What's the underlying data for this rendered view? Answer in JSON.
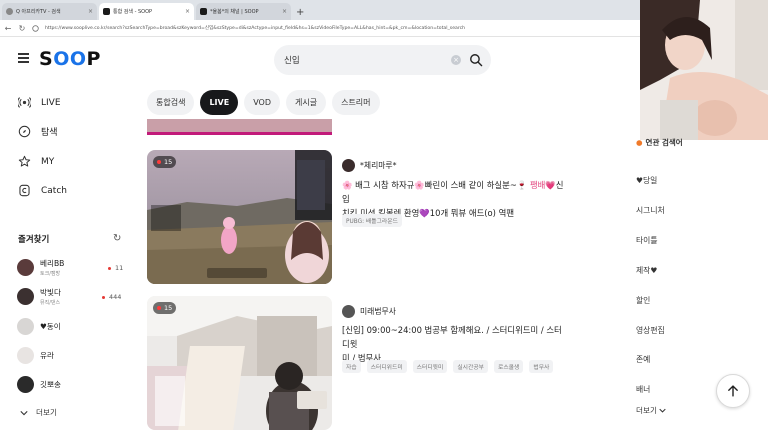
{
  "browser": {
    "tabs": [
      {
        "title": "Q 아프리카TV - 검색",
        "active": false
      },
      {
        "title": "통합 검색 - SOOP",
        "active": true
      },
      {
        "title": "*율봄*의 채널 | SOOP",
        "active": false
      }
    ],
    "new_tab_symbol": "+",
    "url": "https://www.sooplive.co.kr/search?szSearchType=broad&szKeyword=신입&szStype=di&szActype=input_field&hs=1&szVideoFileType=ALL&has_hint=&pk_cm=&location=total_search"
  },
  "header": {
    "logo_text_1": "S",
    "logo_text_2": "OO",
    "logo_text_3": "P",
    "search_value": "신입",
    "clear_symbol": "×"
  },
  "sidebar": {
    "nav": [
      {
        "label": "LIVE",
        "icon": "live-icon"
      },
      {
        "label": "탐색",
        "icon": "explore-icon"
      },
      {
        "label": "MY",
        "icon": "star-icon"
      },
      {
        "label": "Catch",
        "icon": "catch-icon"
      }
    ],
    "favorites_title": "즐겨찾기",
    "favorites": [
      {
        "name": "베리BB",
        "sub": "토크/캠방",
        "count": "11"
      },
      {
        "name": "박빛다",
        "sub": "뮤직/댄스",
        "count": "444"
      },
      {
        "name": "♥동이",
        "sub": "",
        "count": ""
      },
      {
        "name": "유라",
        "sub": "",
        "count": ""
      },
      {
        "name": "깃뽀송",
        "sub": "",
        "count": ""
      }
    ],
    "more_label": "더보기"
  },
  "filter_tabs": [
    {
      "label": "통합검색",
      "active": false
    },
    {
      "label": "LIVE",
      "active": true
    },
    {
      "label": "VOD",
      "active": false
    },
    {
      "label": "게시글",
      "active": false
    },
    {
      "label": "스트리머",
      "active": false
    }
  ],
  "results": [
    {
      "age_badge": "15",
      "streamer": "*체리마루*",
      "title_line1_a": "🌸 배그 시참 하자규",
      "title_line1_b": "🌸",
      "title_line1_c": "빠린이 스배 같이 하실분~",
      "title_line1_d": "🍷 팽배",
      "title_line1_e": "💗",
      "title_line1_f": "신입",
      "title_line2_a": "치킨 미션 킬볼렛 환영",
      "title_line2_b": "💜",
      "title_line2_c": "10개 뭐뷰 애드(o) 역팬",
      "tags": [
        "PUBG: 배틀그라운드"
      ]
    },
    {
      "age_badge": "15",
      "streamer": "미래법무사",
      "title_line1": "[신입] 09:00~24:00 법공부 함께해요. / 스터디위드미 / 스터디윗",
      "title_line2": "미 / 법무사",
      "tags": [
        "자습",
        "스터디위드미",
        "스터디윗미",
        "실시간공부",
        "로스쿨생",
        "법무사"
      ]
    }
  ],
  "right_panel": {
    "head": "연관 검색어",
    "items": [
      "♥당일",
      "시그니처",
      "타이틀",
      "제작♥",
      "할인",
      "영상편집",
      "존예",
      "배너"
    ],
    "more_label": "더보기"
  },
  "colors": {
    "accent_blue": "#1a73e8",
    "live_red": "#ff3b3b",
    "active_tab": "#18191b",
    "title_pink": "#e2457e"
  }
}
